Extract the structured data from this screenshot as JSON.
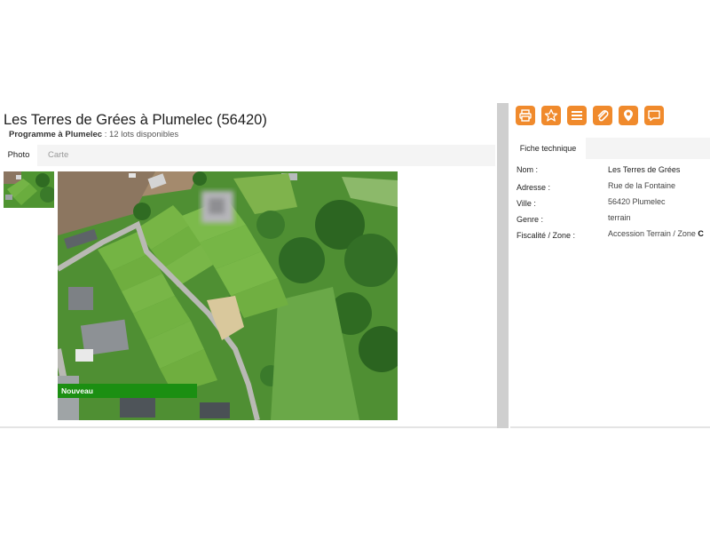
{
  "listing": {
    "title": "Les Terres de Grées à Plumelec (56420)",
    "subtitle_label": "Programme à Plumelec",
    "subtitle_rest": " : 12 lots disponibles"
  },
  "tabs": [
    {
      "label": "Photo",
      "active": true
    },
    {
      "label": "Carte",
      "active": false
    }
  ],
  "photo": {
    "badge": "Nouveau",
    "colors": {
      "badge": "#1b8f12",
      "grass": "#5fa637",
      "trees": "#2f6b22"
    }
  },
  "actions": [
    {
      "icon": "print-icon"
    },
    {
      "icon": "star-icon"
    },
    {
      "icon": "list-icon"
    },
    {
      "icon": "paperclip-icon"
    },
    {
      "icon": "map-pin-icon"
    },
    {
      "icon": "comment-icon"
    }
  ],
  "accent_color": "#f08a2c",
  "fiche": {
    "tab_label": "Fiche technique",
    "rows": [
      {
        "label": "Nom :",
        "value": "Les Terres de Grées"
      },
      {
        "label": "Adresse :",
        "value": "Rue de la Fontaine"
      },
      {
        "label": "Ville :",
        "value": "56420 Plumelec"
      },
      {
        "label": "Genre :",
        "value": "terrain"
      },
      {
        "label": "Fiscalité / Zone :",
        "value": "Accession Terrain / Zone ",
        "zone_code": "C"
      }
    ]
  }
}
